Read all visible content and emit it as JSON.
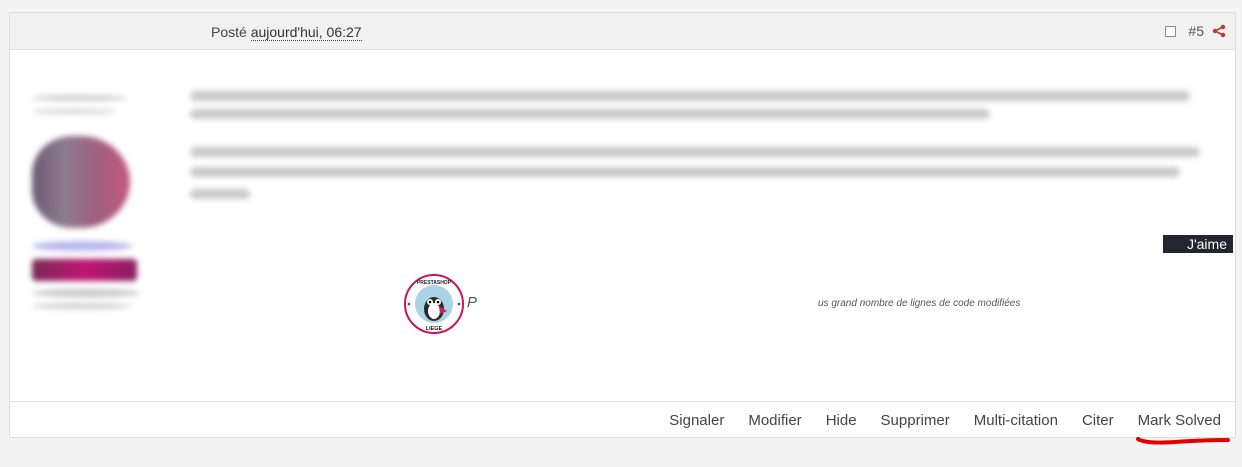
{
  "header": {
    "posted_label": "Posté",
    "posted_time": "aujourd'hui, 06:27",
    "post_number": "#5",
    "share_icon": "share-icon"
  },
  "like": {
    "label": "J'aime"
  },
  "signature": {
    "logo_top_text": "PRESTASHOP",
    "logo_bottom_text": "LIEGE",
    "initial": "P",
    "text": "us grand nombre de lignes de code modifiées"
  },
  "actions": {
    "report": "Signaler",
    "edit": "Modifier",
    "hide": "Hide",
    "delete": "Supprimer",
    "multiquote": "Multi-citation",
    "quote": "Citer",
    "mark_solved": "Mark Solved"
  },
  "colors": {
    "accent_red": "#e50000",
    "share_red": "#c0392b",
    "like_bg": "#25262d",
    "logo_pink": "#c2185b"
  }
}
